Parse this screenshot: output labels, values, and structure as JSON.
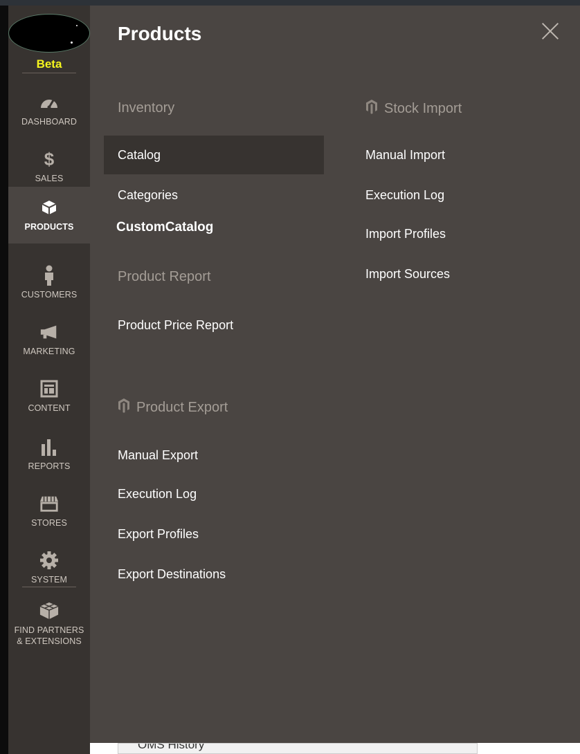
{
  "sidebar": {
    "beta": "Beta",
    "items": [
      {
        "label": "DASHBOARD",
        "icon": "gauge-icon"
      },
      {
        "label": "SALES",
        "icon": "dollar-icon"
      },
      {
        "label": "PRODUCTS",
        "icon": "box-icon",
        "active": true
      },
      {
        "label": "CUSTOMERS",
        "icon": "person-icon"
      },
      {
        "label": "MARKETING",
        "icon": "megaphone-icon"
      },
      {
        "label": "CONTENT",
        "icon": "layout-icon"
      },
      {
        "label": "REPORTS",
        "icon": "bar-chart-icon"
      },
      {
        "label": "STORES",
        "icon": "storefront-icon"
      },
      {
        "label": "SYSTEM",
        "icon": "gear-icon"
      },
      {
        "label": "FIND PARTNERS\n& EXTENSIONS",
        "label_line1": "FIND PARTNERS",
        "label_line2": "& EXTENSIONS",
        "icon": "cubes-icon"
      }
    ],
    "dollar_glyph": "$"
  },
  "panel": {
    "title": "Products",
    "left_column": {
      "inventory": {
        "title": "Inventory",
        "links": [
          "Catalog",
          "Categories",
          "CustomCatalog"
        ]
      },
      "product_report": {
        "title": "Product Report",
        "links": [
          "Product Price Report"
        ]
      },
      "product_export": {
        "title": "Product Export",
        "links": [
          "Manual Export",
          "Execution Log",
          "Export Profiles",
          "Export Destinations"
        ]
      }
    },
    "right_column": {
      "stock_import": {
        "title": "Stock Import",
        "links": [
          "Manual Import",
          "Execution Log",
          "Import Profiles",
          "Import Sources"
        ]
      }
    }
  },
  "background_content": {
    "partial_text": "OMS History"
  },
  "colors": {
    "sidebar_bg": "#373330",
    "panel_bg": "#4a4542",
    "highlight_bg": "#373330",
    "beta_color": "#f5f51e",
    "section_title": "#a49d96"
  }
}
